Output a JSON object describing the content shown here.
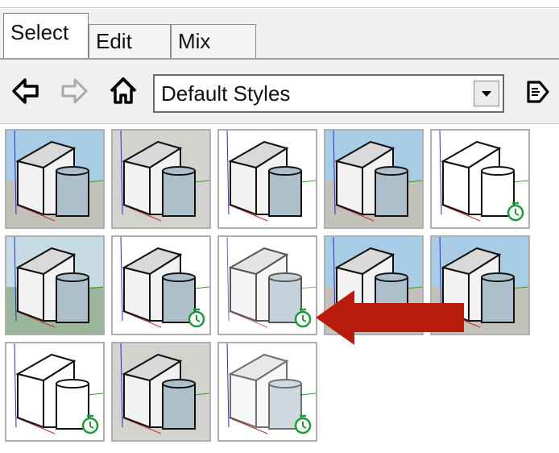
{
  "tabs": [
    {
      "label": "Select",
      "active": true
    },
    {
      "label": "Edit",
      "active": false
    },
    {
      "label": "Mix",
      "active": false
    }
  ],
  "toolbar": {
    "back_icon": "back-arrow-icon",
    "forward_icon": "forward-arrow-icon",
    "home_icon": "home-icon",
    "collection_value": "Default Styles",
    "details_icon": "details-arrow-icon"
  },
  "styles": [
    {
      "variant": "sky"
    },
    {
      "variant": "gray"
    },
    {
      "variant": "plain"
    },
    {
      "variant": "sky"
    },
    {
      "variant": "sketch",
      "timer": true
    },
    {
      "variant": "green"
    },
    {
      "variant": "plain",
      "timer": true
    },
    {
      "variant": "faded",
      "timer": true
    },
    {
      "variant": "sky"
    },
    {
      "variant": "sky"
    },
    {
      "variant": "wire",
      "timer": true
    },
    {
      "variant": "gray"
    },
    {
      "variant": "xray",
      "timer": true
    }
  ],
  "colors": {
    "arrow": "#b71c0c",
    "timer": "#1f9a3a",
    "cylinder": "#aebfcc",
    "sky": "#a8cbe6",
    "ground": "#c2c2bb"
  }
}
